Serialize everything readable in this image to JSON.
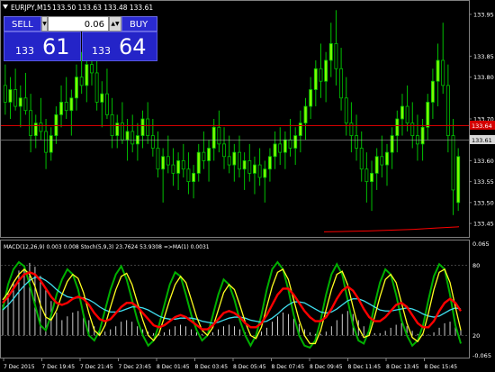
{
  "symbol_header": {
    "symbol": "EURJPY,M15",
    "ohlc": "133.50 133.63 133.48 133.61"
  },
  "one_click_trading": {
    "sell_label": "SELL",
    "buy_label": "BUY",
    "lot_size": "0.06",
    "sell_price_prefix": "133",
    "sell_price_pips": "61",
    "buy_price_prefix": "133",
    "buy_price_pips": "64"
  },
  "price_axis": {
    "ticks": [
      "133.95",
      "133.85",
      "133.80",
      "133.70",
      "133.65",
      "133.60",
      "133.55",
      "133.50",
      "133.45"
    ],
    "bid_label": "133.61",
    "ask_label": "133.64"
  },
  "indicator_header": "MACD(12,26,9) 0.003 0.008  Stoch(5,9,3) 23.7624 53.9308  =>MA(1) 0.0031",
  "indicator_axis": {
    "ticks": [
      "0.065",
      "80",
      "20",
      "-0.065"
    ],
    "level_high": 80,
    "level_low": 20
  },
  "time_axis": [
    "7 Dec 2015",
    "7 Dec 19:45",
    "7 Dec 21:45",
    "7 Dec 23:45",
    "8 Dec 01:45",
    "8 Dec 03:45",
    "8 Dec 05:45",
    "8 Dec 07:45",
    "8 Dec 09:45",
    "8 Dec 11:45",
    "8 Dec 13:45",
    "8 Dec 15:45"
  ],
  "colors": {
    "background": "#000000",
    "bull_candle": "#7CFC00",
    "bear_candle": "#000000",
    "candle_wick": "#00C000",
    "ask_line": "#d40000",
    "bid_line": "#c8c8c8",
    "ma_line": "#ff0000",
    "macd_hist": "#ffffff",
    "stoch_main": "#00b000",
    "line_cyan": "#40e0f0",
    "line_yellow": "#ffff20",
    "line_red": "#ff0000",
    "panel_blue": "#2424c8"
  },
  "chart_data": {
    "type": "candlestick",
    "symbol": "EURJPY",
    "timeframe": "M15",
    "bid": 133.61,
    "ask": 133.64,
    "ylim": [
      133.42,
      133.98
    ],
    "candles": [
      [
        133.78,
        133.83,
        133.71,
        133.74
      ],
      [
        133.74,
        133.8,
        133.7,
        133.77
      ],
      [
        133.77,
        133.82,
        133.72,
        133.73
      ],
      [
        133.73,
        133.78,
        133.68,
        133.75
      ],
      [
        133.75,
        133.81,
        133.71,
        133.72
      ],
      [
        133.72,
        133.76,
        133.62,
        133.66
      ],
      [
        133.66,
        133.71,
        133.63,
        133.69
      ],
      [
        133.69,
        133.75,
        133.65,
        133.67
      ],
      [
        133.67,
        133.7,
        133.58,
        133.62
      ],
      [
        133.62,
        133.68,
        133.6,
        133.66
      ],
      [
        133.66,
        133.73,
        133.64,
        133.71
      ],
      [
        133.71,
        133.78,
        133.68,
        133.74
      ],
      [
        133.74,
        133.8,
        133.7,
        133.72
      ],
      [
        133.72,
        133.77,
        133.66,
        133.75
      ],
      [
        133.75,
        133.83,
        133.72,
        133.8
      ],
      [
        133.8,
        133.86,
        133.76,
        133.78
      ],
      [
        133.78,
        133.85,
        133.74,
        133.83
      ],
      [
        133.83,
        133.9,
        133.78,
        133.81
      ],
      [
        133.81,
        133.86,
        133.72,
        133.74
      ],
      [
        133.74,
        133.79,
        133.68,
        133.76
      ],
      [
        133.76,
        133.82,
        133.7,
        133.71
      ],
      [
        133.71,
        133.75,
        133.63,
        133.66
      ],
      [
        133.66,
        133.71,
        133.63,
        133.69
      ],
      [
        133.69,
        133.74,
        133.64,
        133.65
      ],
      [
        133.65,
        133.7,
        133.6,
        133.67
      ],
      [
        133.67,
        133.71,
        133.62,
        133.64
      ],
      [
        133.64,
        133.69,
        133.6,
        133.66
      ],
      [
        133.66,
        133.72,
        133.63,
        133.7
      ],
      [
        133.7,
        133.74,
        133.64,
        133.66
      ],
      [
        133.66,
        133.7,
        133.61,
        133.63
      ],
      [
        133.63,
        133.67,
        133.56,
        133.58
      ],
      [
        133.58,
        133.63,
        133.5,
        133.61
      ],
      [
        133.61,
        133.66,
        133.57,
        133.59
      ],
      [
        133.59,
        133.63,
        133.54,
        133.57
      ],
      [
        133.57,
        133.62,
        133.53,
        133.6
      ],
      [
        133.6,
        133.64,
        133.56,
        133.58
      ],
      [
        133.58,
        133.62,
        133.52,
        133.55
      ],
      [
        133.55,
        133.59,
        133.51,
        133.57
      ],
      [
        133.57,
        133.64,
        133.55,
        133.62
      ],
      [
        133.62,
        133.67,
        133.58,
        133.6
      ],
      [
        133.6,
        133.65,
        133.55,
        133.63
      ],
      [
        133.63,
        133.7,
        133.6,
        133.68
      ],
      [
        133.68,
        133.72,
        133.62,
        133.64
      ],
      [
        133.64,
        133.68,
        133.58,
        133.61
      ],
      [
        133.61,
        133.66,
        133.57,
        133.59
      ],
      [
        133.59,
        133.64,
        133.55,
        133.62
      ],
      [
        133.62,
        133.66,
        133.56,
        133.58
      ],
      [
        133.58,
        133.62,
        133.53,
        133.6
      ],
      [
        133.6,
        133.64,
        133.55,
        133.57
      ],
      [
        133.57,
        133.61,
        133.52,
        133.59
      ],
      [
        133.59,
        133.63,
        133.54,
        133.56
      ],
      [
        133.56,
        133.6,
        133.5,
        133.58
      ],
      [
        133.58,
        133.63,
        133.55,
        133.61
      ],
      [
        133.61,
        133.67,
        133.58,
        133.64
      ],
      [
        133.64,
        133.68,
        133.59,
        133.62
      ],
      [
        133.62,
        133.67,
        133.58,
        133.65
      ],
      [
        133.65,
        133.7,
        133.61,
        133.63
      ],
      [
        133.63,
        133.68,
        133.59,
        133.66
      ],
      [
        133.66,
        133.72,
        133.62,
        133.69
      ],
      [
        133.69,
        133.75,
        133.65,
        133.73
      ],
      [
        133.73,
        133.8,
        133.7,
        133.77
      ],
      [
        133.77,
        133.84,
        133.73,
        133.82
      ],
      [
        133.82,
        133.88,
        133.75,
        133.79
      ],
      [
        133.79,
        133.86,
        133.74,
        133.84
      ],
      [
        133.84,
        133.93,
        133.8,
        133.88
      ],
      [
        133.88,
        133.96,
        133.78,
        133.82
      ],
      [
        133.82,
        133.87,
        133.72,
        133.75
      ],
      [
        133.75,
        133.8,
        133.66,
        133.69
      ],
      [
        133.69,
        133.74,
        133.62,
        133.66
      ],
      [
        133.66,
        133.71,
        133.6,
        133.63
      ],
      [
        133.63,
        133.67,
        133.55,
        133.58
      ],
      [
        133.58,
        133.62,
        133.5,
        133.55
      ],
      [
        133.55,
        133.6,
        133.48,
        133.57
      ],
      [
        133.57,
        133.63,
        133.53,
        133.61
      ],
      [
        133.61,
        133.66,
        133.56,
        133.59
      ],
      [
        133.59,
        133.64,
        133.54,
        133.62
      ],
      [
        133.62,
        133.68,
        133.58,
        133.66
      ],
      [
        133.66,
        133.72,
        133.62,
        133.7
      ],
      [
        133.7,
        133.76,
        133.66,
        133.73
      ],
      [
        133.73,
        133.78,
        133.67,
        133.69
      ],
      [
        133.69,
        133.74,
        133.63,
        133.66
      ],
      [
        133.66,
        133.71,
        133.6,
        133.64
      ],
      [
        133.64,
        133.7,
        133.6,
        133.68
      ],
      [
        133.68,
        133.76,
        133.65,
        133.74
      ],
      [
        133.74,
        133.82,
        133.7,
        133.79
      ],
      [
        133.79,
        133.88,
        133.73,
        133.84
      ],
      [
        133.84,
        133.93,
        133.76,
        133.78
      ],
      [
        133.78,
        133.83,
        133.62,
        133.66
      ],
      [
        133.66,
        133.7,
        133.47,
        133.53
      ],
      [
        133.5,
        133.63,
        133.48,
        133.61
      ]
    ],
    "ma_line": [
      133.43,
      133.431,
      133.432,
      133.434,
      133.436,
      133.439,
      133.442
    ],
    "indicator": {
      "range": [
        0,
        100
      ],
      "levels": [
        80,
        20
      ],
      "stoch_main": [
        45,
        70,
        85,
        92,
        88,
        70,
        50,
        30,
        25,
        40,
        60,
        75,
        85,
        80,
        65,
        40,
        20,
        15,
        25,
        45,
        65,
        80,
        88,
        75,
        55,
        35,
        20,
        10,
        15,
        30,
        50,
        70,
        82,
        78,
        60,
        40,
        25,
        15,
        20,
        40,
        60,
        75,
        70,
        55,
        35,
        20,
        10,
        20,
        40,
        65,
        85,
        92,
        85,
        65,
        40,
        20,
        10,
        8,
        15,
        35,
        60,
        80,
        90,
        80,
        55,
        30,
        15,
        12,
        25,
        50,
        72,
        85,
        80,
        60,
        35,
        20,
        10,
        15,
        30,
        55,
        78,
        90,
        85,
        60,
        30,
        12
      ],
      "stoch_signal": [
        55,
        62,
        72,
        80,
        85,
        80,
        68,
        50,
        38,
        35,
        45,
        60,
        73,
        80,
        76,
        62,
        42,
        25,
        20,
        30,
        48,
        65,
        78,
        81,
        70,
        52,
        35,
        20,
        15,
        22,
        38,
        55,
        70,
        78,
        72,
        55,
        38,
        25,
        20,
        28,
        45,
        62,
        70,
        65,
        50,
        33,
        20,
        17,
        28,
        48,
        68,
        82,
        85,
        75,
        55,
        35,
        20,
        12,
        12,
        25,
        45,
        65,
        80,
        83,
        70,
        48,
        28,
        18,
        20,
        38,
        58,
        75,
        80,
        72,
        52,
        32,
        18,
        14,
        22,
        42,
        65,
        82,
        85,
        72,
        48,
        25
      ],
      "macd_main": [
        52,
        58,
        66,
        74,
        80,
        82,
        80,
        74,
        66,
        58,
        52,
        50,
        52,
        56,
        58,
        56,
        50,
        42,
        36,
        34,
        36,
        42,
        48,
        52,
        52,
        48,
        42,
        36,
        30,
        28,
        30,
        34,
        38,
        40,
        38,
        34,
        30,
        26,
        26,
        30,
        36,
        42,
        44,
        42,
        38,
        32,
        28,
        28,
        32,
        40,
        50,
        60,
        66,
        66,
        60,
        52,
        44,
        38,
        34,
        34,
        38,
        46,
        56,
        64,
        68,
        64,
        56,
        46,
        38,
        34,
        34,
        38,
        44,
        50,
        52,
        48,
        40,
        32,
        28,
        28,
        34,
        44,
        52,
        56,
        52,
        44
      ],
      "macd_signal": [
        45,
        50,
        56,
        63,
        69,
        74,
        77,
        77,
        74,
        70,
        65,
        61,
        58,
        57,
        57,
        57,
        55,
        52,
        48,
        45,
        43,
        43,
        44,
        46,
        48,
        48,
        47,
        45,
        42,
        39,
        37,
        36,
        36,
        37,
        37,
        37,
        36,
        34,
        33,
        32,
        33,
        35,
        37,
        38,
        38,
        37,
        35,
        34,
        33,
        34,
        37,
        41,
        46,
        50,
        53,
        53,
        52,
        49,
        46,
        43,
        42,
        43,
        46,
        50,
        54,
        56,
        56,
        54,
        51,
        48,
        45,
        44,
        44,
        45,
        46,
        47,
        46,
        44,
        41,
        39,
        38,
        39,
        42,
        45,
        47,
        46
      ],
      "histogram": [
        40,
        55,
        70,
        85,
        92,
        95,
        90,
        78,
        60,
        45,
        30,
        20,
        25,
        30,
        32,
        28,
        20,
        12,
        8,
        5,
        8,
        12,
        18,
        20,
        18,
        12,
        8,
        5,
        3,
        2,
        4,
        8,
        12,
        14,
        12,
        8,
        4,
        2,
        2,
        4,
        8,
        12,
        14,
        12,
        8,
        4,
        2,
        2,
        5,
        10,
        18,
        25,
        30,
        28,
        22,
        15,
        8,
        4,
        2,
        2,
        5,
        12,
        20,
        28,
        32,
        28,
        20,
        12,
        6,
        3,
        3,
        6,
        10,
        14,
        16,
        12,
        6,
        2,
        1,
        1,
        4,
        10,
        16,
        18,
        14,
        8
      ],
      "last_red_value": 33
    }
  }
}
